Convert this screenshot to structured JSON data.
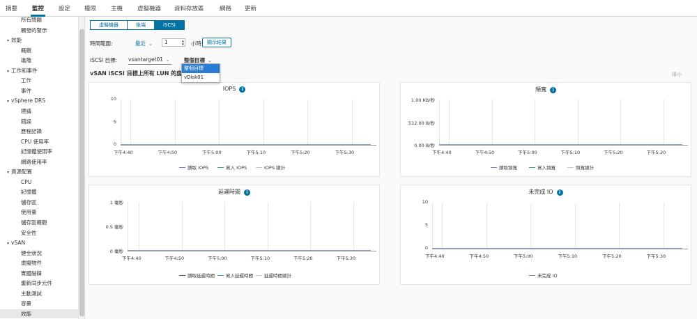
{
  "topnav": {
    "tabs": [
      "摘要",
      "監控",
      "設定",
      "權限",
      "主機",
      "虛擬機器",
      "資料存放區",
      "網路",
      "更新"
    ],
    "active": "監控"
  },
  "sidebar": {
    "items": [
      {
        "label": "所有問題",
        "caret": ""
      },
      {
        "label": "觸發的警示",
        "caret": ""
      },
      {
        "label": "效能",
        "caret": "▾"
      },
      {
        "label": "概觀",
        "caret": ""
      },
      {
        "label": "進階",
        "caret": ""
      },
      {
        "label": "工作和事件",
        "caret": "▾"
      },
      {
        "label": "工作",
        "caret": ""
      },
      {
        "label": "事件",
        "caret": ""
      },
      {
        "label": "vSphere DRS",
        "caret": "▾"
      },
      {
        "label": "建議",
        "caret": ""
      },
      {
        "label": "錯誤",
        "caret": ""
      },
      {
        "label": "歷程記錄",
        "caret": ""
      },
      {
        "label": "CPU 使用率",
        "caret": ""
      },
      {
        "label": "記憶體使用率",
        "caret": ""
      },
      {
        "label": "網路使用率",
        "caret": ""
      },
      {
        "label": "資源配置",
        "caret": "▾"
      },
      {
        "label": "CPU",
        "caret": ""
      },
      {
        "label": "記憶體",
        "caret": ""
      },
      {
        "label": "儲存區",
        "caret": ""
      },
      {
        "label": "使用量",
        "caret": ""
      },
      {
        "label": "儲存區概觀",
        "caret": ""
      },
      {
        "label": "安全性",
        "caret": ""
      },
      {
        "label": "vSAN",
        "caret": "▾"
      },
      {
        "label": "健全狀況",
        "caret": ""
      },
      {
        "label": "虛擬物件",
        "caret": ""
      },
      {
        "label": "實體磁碟",
        "caret": ""
      },
      {
        "label": "重新同步元件",
        "caret": ""
      },
      {
        "label": "主動測試",
        "caret": ""
      },
      {
        "label": "容量",
        "caret": ""
      },
      {
        "label": "效能",
        "caret": ""
      }
    ],
    "selected": "效能"
  },
  "segments": [
    "虛擬機器",
    "後端",
    "iSCSI"
  ],
  "segments_active": "iSCSI",
  "timerange": {
    "label": "時間範圍:",
    "select": "最近",
    "value": "1",
    "unit": "小時",
    "button": "顯示結果"
  },
  "target": {
    "label": "iSCSI 目標:",
    "value": "vsantarget01",
    "lun_select": "整個目標"
  },
  "dropdown": {
    "options": [
      "整個目標",
      "vDisk01"
    ],
    "highlighted": "整個目標"
  },
  "section_title": "vSAN iSCSI 目標上所有 LUN 的度量",
  "collapse_label": "隱小",
  "charts": [
    {
      "title": "IOPS",
      "yticks": [
        "10",
        "5",
        "0"
      ],
      "xticks": [
        "下午4:40",
        "下午4:50",
        "下午5:00",
        "下午5:10",
        "下午5:20",
        "下午5:30"
      ],
      "legend": [
        {
          "label": "讀取 IOPS",
          "color": "#7a7ad0"
        },
        {
          "label": "寫入 IOPS",
          "color": "#3a9fb8"
        },
        {
          "label": "IOPS 總計",
          "color": "#c8c8c8"
        }
      ]
    },
    {
      "title": "頻寬",
      "yticks": [
        "1.00 KB/秒",
        "512.00 B/秒",
        "0.00 B/秒"
      ],
      "xticks": [
        "下午4:40",
        "下午4:50",
        "下午5:00",
        "下午5:10",
        "下午5:20",
        "下午5:30"
      ],
      "legend": [
        {
          "label": "讀取頻寬",
          "color": "#7a7ad0"
        },
        {
          "label": "寫入頻寬",
          "color": "#3a9fb8"
        },
        {
          "label": "頻寬總計",
          "color": "#c8c8c8"
        }
      ]
    },
    {
      "title": "延遲時間",
      "yticks": [
        "1 毫秒",
        "0.5 毫秒",
        "0 毫秒"
      ],
      "xticks": [
        "下午4:40",
        "下午4:50",
        "下午5:00",
        "下午5:10",
        "下午5:20",
        "下午5:30"
      ],
      "legend": [
        {
          "label": "讀取延遲時間",
          "color": "#555555"
        },
        {
          "label": "寫入延遲時間",
          "color": "#3a9fb8"
        },
        {
          "label": "延遲時間總計",
          "color": "#c8c8c8"
        }
      ]
    },
    {
      "title": "未完成 IO",
      "yticks": [
        "10",
        "5",
        "0"
      ],
      "xticks": [
        "下午4:40",
        "下午4:50",
        "下午5:00",
        "下午5:10",
        "下午5:20",
        "下午5:30"
      ],
      "legend": [
        {
          "label": "未完成 IO",
          "color": "#7a7ad0"
        }
      ]
    }
  ]
}
